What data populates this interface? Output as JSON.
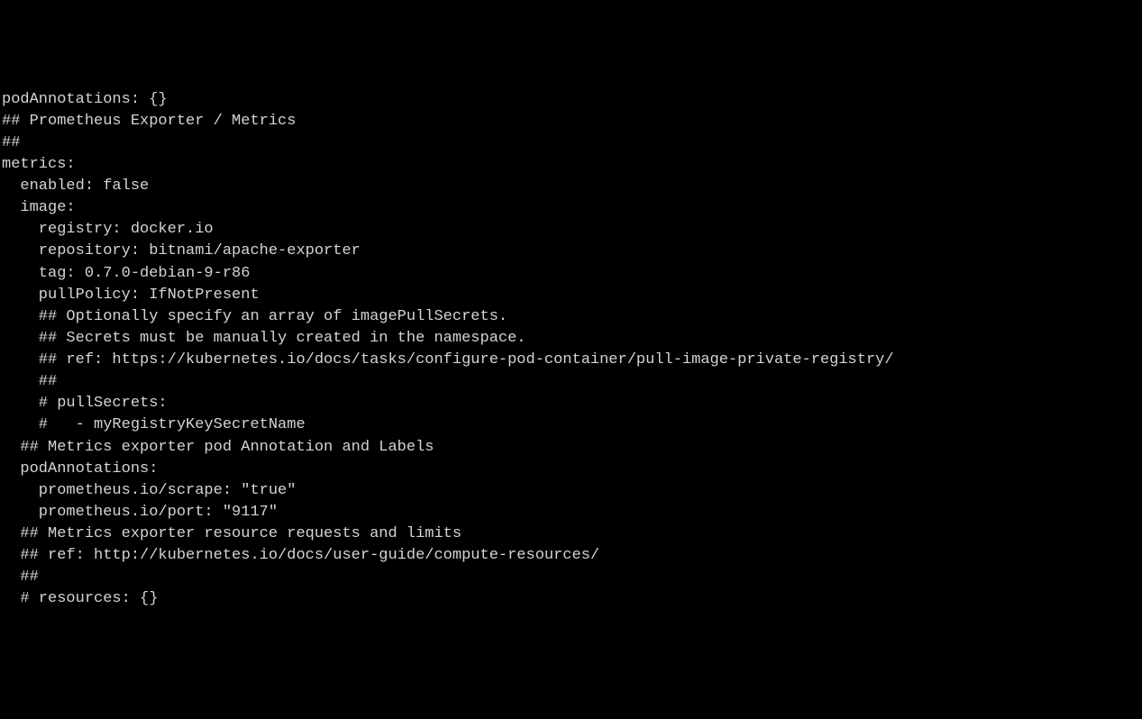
{
  "lines": [
    "podAnnotations: {}",
    "## Prometheus Exporter / Metrics",
    "##",
    "metrics:",
    "  enabled: false",
    "  image:",
    "    registry: docker.io",
    "    repository: bitnami/apache-exporter",
    "    tag: 0.7.0-debian-9-r86",
    "    pullPolicy: IfNotPresent",
    "    ## Optionally specify an array of imagePullSecrets.",
    "    ## Secrets must be manually created in the namespace.",
    "    ## ref: https://kubernetes.io/docs/tasks/configure-pod-container/pull-image-private-registry/",
    "    ##",
    "    # pullSecrets:",
    "    #   - myRegistryKeySecretName",
    "  ## Metrics exporter pod Annotation and Labels",
    "  podAnnotations:",
    "    prometheus.io/scrape: \"true\"",
    "    prometheus.io/port: \"9117\"",
    "  ## Metrics exporter resource requests and limits",
    "  ## ref: http://kubernetes.io/docs/user-guide/compute-resources/",
    "  ##",
    "  # resources: {}"
  ]
}
